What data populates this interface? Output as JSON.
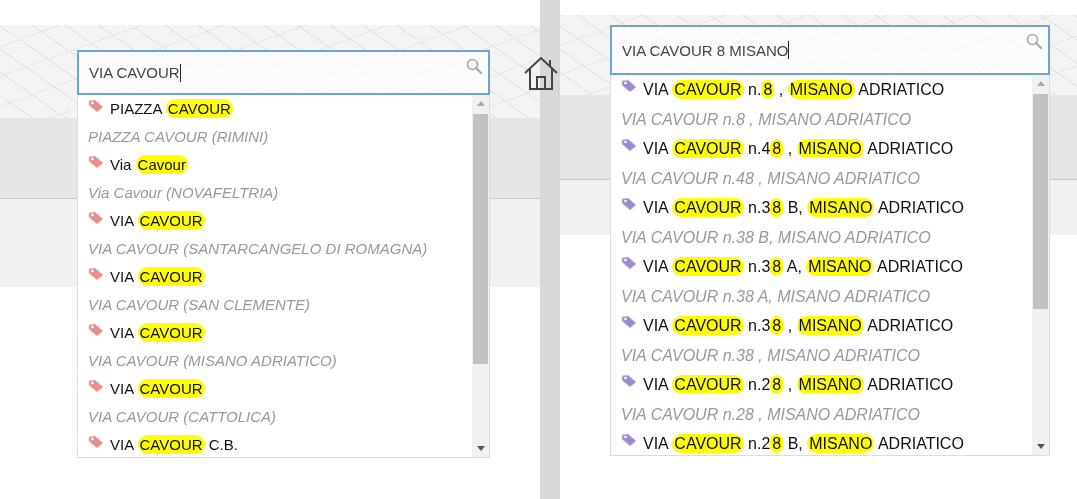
{
  "panels": [
    {
      "search": {
        "value": "VIA CAVOUR"
      },
      "home_button": true,
      "color": "#f08a8a",
      "suggestions": [
        {
          "title": [
            {
              "text": "PIAZZA ",
              "match": false
            },
            {
              "text": "CAVOUR",
              "match": true
            }
          ],
          "subtitle": "PIAZZA CAVOUR (RIMINI)"
        },
        {
          "title": [
            {
              "text": "Via ",
              "match": false
            },
            {
              "text": "Cavour",
              "match": true
            }
          ],
          "subtitle": "Via Cavour (NOVAFELTRIA)"
        },
        {
          "title": [
            {
              "text": "VIA ",
              "match": false
            },
            {
              "text": "CAVOUR",
              "match": true
            }
          ],
          "subtitle": "VIA CAVOUR (SANTARCANGELO DI ROMAGNA)"
        },
        {
          "title": [
            {
              "text": "VIA ",
              "match": false
            },
            {
              "text": "CAVOUR",
              "match": true
            }
          ],
          "subtitle": "VIA CAVOUR (SAN CLEMENTE)"
        },
        {
          "title": [
            {
              "text": "VIA ",
              "match": false
            },
            {
              "text": "CAVOUR",
              "match": true
            }
          ],
          "subtitle": "VIA CAVOUR (MISANO ADRIATICO)"
        },
        {
          "title": [
            {
              "text": "VIA ",
              "match": false
            },
            {
              "text": "CAVOUR",
              "match": true
            }
          ],
          "subtitle": "VIA CAVOUR (CATTOLICA)"
        },
        {
          "title": [
            {
              "text": "VIA ",
              "match": false
            },
            {
              "text": "CAVOUR",
              "match": true
            },
            {
              "text": " C.B.",
              "match": false
            }
          ]
        }
      ]
    },
    {
      "search": {
        "value": "VIA CAVOUR 8 MISANO"
      },
      "home_button": false,
      "color": "#9b86d8",
      "suggestions": [
        {
          "title": [
            {
              "text": "VIA ",
              "match": false
            },
            {
              "text": "CAVOUR",
              "match": true
            },
            {
              "text": " n.",
              "match": false
            },
            {
              "text": "8",
              "match": true
            },
            {
              "text": " , ",
              "match": false
            },
            {
              "text": "MISANO",
              "match": true
            },
            {
              "text": " ADRIATICO",
              "match": false
            }
          ],
          "subtitle": "VIA CAVOUR n.8 , MISANO ADRIATICO"
        },
        {
          "title": [
            {
              "text": "VIA ",
              "match": false
            },
            {
              "text": "CAVOUR",
              "match": true
            },
            {
              "text": " n.4",
              "match": false
            },
            {
              "text": "8",
              "match": true
            },
            {
              "text": " , ",
              "match": false
            },
            {
              "text": "MISANO",
              "match": true
            },
            {
              "text": " ADRIATICO",
              "match": false
            }
          ],
          "subtitle": "VIA CAVOUR n.48 , MISANO ADRIATICO"
        },
        {
          "title": [
            {
              "text": "VIA ",
              "match": false
            },
            {
              "text": "CAVOUR",
              "match": true
            },
            {
              "text": " n.3",
              "match": false
            },
            {
              "text": "8",
              "match": true
            },
            {
              "text": " B, ",
              "match": false
            },
            {
              "text": "MISANO",
              "match": true
            },
            {
              "text": " ADRIATICO",
              "match": false
            }
          ],
          "subtitle": "VIA CAVOUR n.38 B, MISANO ADRIATICO"
        },
        {
          "title": [
            {
              "text": "VIA ",
              "match": false
            },
            {
              "text": "CAVOUR",
              "match": true
            },
            {
              "text": " n.3",
              "match": false
            },
            {
              "text": "8",
              "match": true
            },
            {
              "text": " A, ",
              "match": false
            },
            {
              "text": "MISANO",
              "match": true
            },
            {
              "text": " ADRIATICO",
              "match": false
            }
          ],
          "subtitle": "VIA CAVOUR n.38 A, MISANO ADRIATICO"
        },
        {
          "title": [
            {
              "text": "VIA ",
              "match": false
            },
            {
              "text": "CAVOUR",
              "match": true
            },
            {
              "text": " n.3",
              "match": false
            },
            {
              "text": "8",
              "match": true
            },
            {
              "text": " , ",
              "match": false
            },
            {
              "text": "MISANO",
              "match": true
            },
            {
              "text": " ADRIATICO",
              "match": false
            }
          ],
          "subtitle": "VIA CAVOUR n.38 , MISANO ADRIATICO"
        },
        {
          "title": [
            {
              "text": "VIA ",
              "match": false
            },
            {
              "text": "CAVOUR",
              "match": true
            },
            {
              "text": " n.2",
              "match": false
            },
            {
              "text": "8",
              "match": true
            },
            {
              "text": " , ",
              "match": false
            },
            {
              "text": "MISANO",
              "match": true
            },
            {
              "text": " ADRIATICO",
              "match": false
            }
          ],
          "subtitle": "VIA CAVOUR n.28 , MISANO ADRIATICO"
        },
        {
          "title": [
            {
              "text": "VIA ",
              "match": false
            },
            {
              "text": "CAVOUR",
              "match": true
            },
            {
              "text": " n.2",
              "match": false
            },
            {
              "text": "8",
              "match": true
            },
            {
              "text": " B, ",
              "match": false
            },
            {
              "text": "MISANO",
              "match": true
            },
            {
              "text": " ADRIATICO",
              "match": false
            }
          ]
        }
      ]
    }
  ]
}
